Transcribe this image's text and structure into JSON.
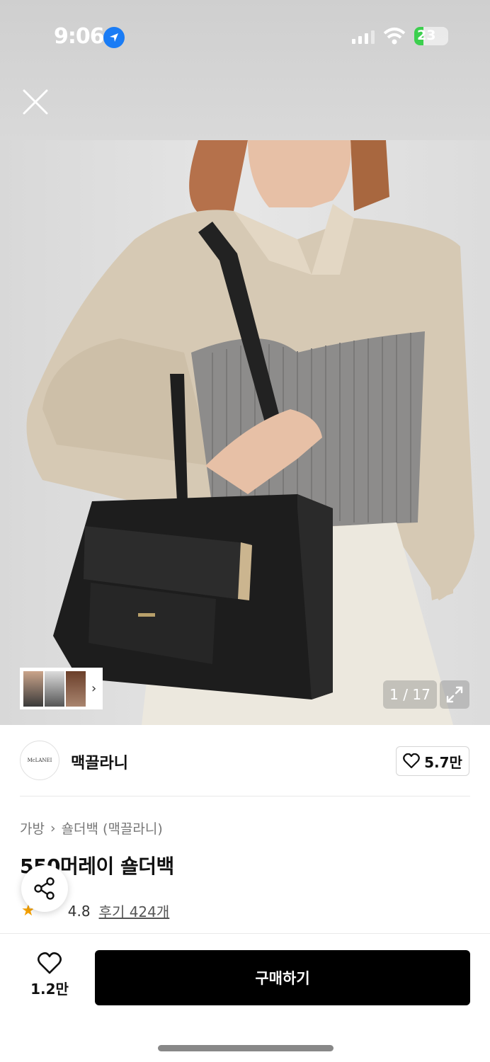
{
  "status_bar": {
    "time": "9:06",
    "battery": "23"
  },
  "header": {
    "close_icon": "close-icon",
    "home_icon": "home-icon",
    "search_icon": "search-icon",
    "cart_icon": "shopping-bag-icon"
  },
  "gallery": {
    "counter": "1 / 17",
    "expand_icon": "expand-icon",
    "thumb_arrow": "›"
  },
  "brand": {
    "name": "맥끌라니",
    "logo_text": "McLANEI",
    "likes": "5.7만"
  },
  "product": {
    "breadcrumb": [
      "가방",
      "숄더백 (맥끌라니)"
    ],
    "breadcrumb_sep": "›",
    "title": "550머레이 숄더백",
    "rating": "4.8",
    "reviews": "후기 424개"
  },
  "bottom": {
    "wish_count": "1.2만",
    "buy_label": "구매하기"
  },
  "colors": {
    "accent": "#000000",
    "star": "#f5a100",
    "status_blue": "#1a7cf5",
    "battery_green": "#3ccf4e"
  }
}
